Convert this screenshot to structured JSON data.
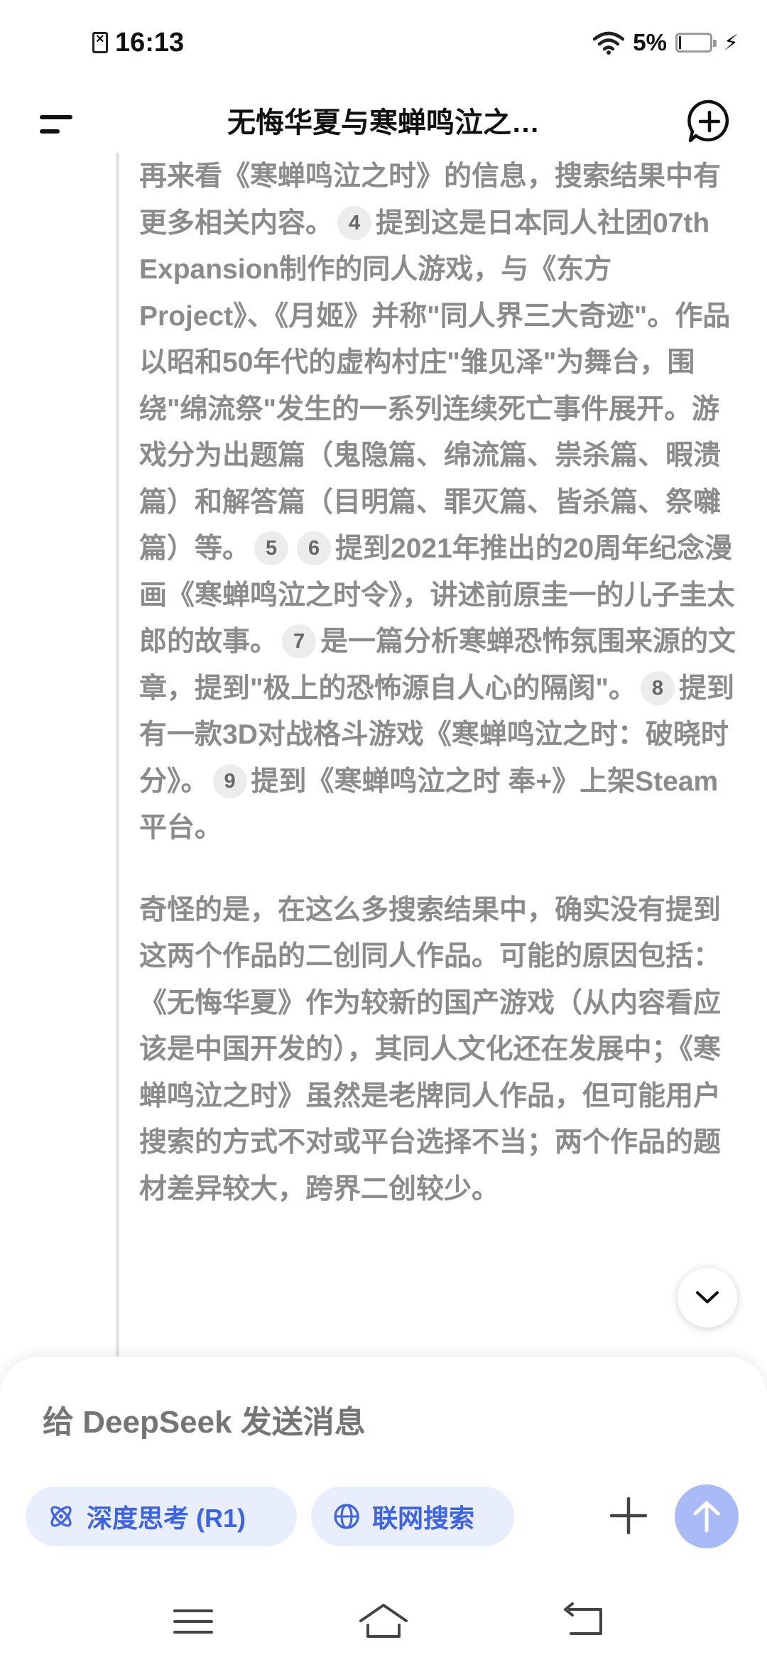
{
  "status_bar": {
    "time": "16:13",
    "battery_percent": "5%",
    "battery_level": 0.05,
    "icons": [
      "sim-error-icon",
      "wifi-icon",
      "battery-icon",
      "charging-icon"
    ]
  },
  "header": {
    "title": "无悔华夏与寒蝉鸣泣之…",
    "menu_icon": "menu-icon",
    "new_chat_icon": "new-chat-icon"
  },
  "conversation": {
    "paragraph1": [
      {
        "t": "text",
        "v": "再来看《寒蝉鸣泣之时》的信息，搜索结果中有更多相关内容。"
      },
      {
        "t": "cite",
        "v": "4"
      },
      {
        "t": "text",
        "v": "提到这是日本同人社团07th Expansion制作的同人游戏，与《东方Project》、《月姬》并称\"同人界三大奇迹\"。作品以昭和50年代的虚构村庄\"雏见泽\"为舞台，围绕\"绵流祭\"发生的一系列连续死亡事件展开。游戏分为出题篇（鬼隐篇、绵流篇、祟杀篇、暇溃篇）和解答篇（目明篇、罪灭篇、皆杀篇、祭囃篇）等。"
      },
      {
        "t": "cite",
        "v": "5"
      },
      {
        "t": "cite",
        "v": "6"
      },
      {
        "t": "text",
        "v": "提到2021年推出的20周年纪念漫画《寒蝉鸣泣之时令》，讲述前原圭一的儿子圭太郎的故事。"
      },
      {
        "t": "cite",
        "v": "7"
      },
      {
        "t": "text",
        "v": "是一篇分析寒蝉恐怖氛围来源的文章，提到\"极上的恐怖源自人心的隔阂\"。"
      },
      {
        "t": "cite",
        "v": "8"
      },
      {
        "t": "text",
        "v": "提到有一款3D对战格斗游戏《寒蝉鸣泣之时：破晓时分》。"
      },
      {
        "t": "cite",
        "v": "9"
      },
      {
        "t": "text",
        "v": "提到《寒蝉鸣泣之时 奉+》上架Steam平台。"
      }
    ],
    "paragraph2": "奇怪的是，在这么多搜索结果中，确实没有提到这两个作品的二创同人作品。可能的原因包括：《无悔华夏》作为较新的国产游戏（从内容看应该是中国开发的），其同人文化还在发展中；《寒蝉鸣泣之时》虽然是老牌同人作品，但可能用户搜索的方式不对或平台选择不当；两个作品的题材差异较大，跨界二创较少。"
  },
  "input": {
    "placeholder": "给 DeepSeek 发送消息",
    "value": ""
  },
  "toolbar": {
    "deep_think_label": "深度思考 (R1)",
    "web_search_label": "联网搜索",
    "accent_color": "#3c63e8",
    "send_color": "#aab9f7"
  },
  "nav": {
    "icons": [
      "recent-apps-icon",
      "home-icon",
      "back-icon"
    ]
  }
}
